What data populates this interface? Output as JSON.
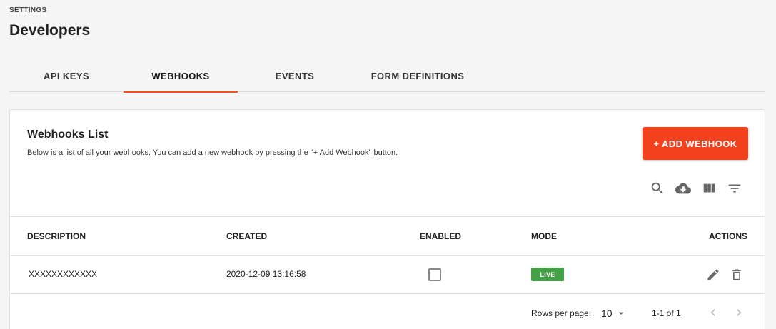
{
  "header": {
    "section_label": "SETTINGS",
    "title": "Developers"
  },
  "tabs": [
    {
      "label": "API KEYS",
      "active": false
    },
    {
      "label": "WEBHOOKS",
      "active": true
    },
    {
      "label": "EVENTS",
      "active": false
    },
    {
      "label": "FORM DEFINITIONS",
      "active": false
    }
  ],
  "card": {
    "title": "Webhooks List",
    "subtitle": "Below is a list of all your webhooks. You can add a new webhook by pressing the \"+ Add Webhook\" button.",
    "add_button_label": "+ ADD WEBHOOK",
    "toolbar_icons": [
      "search-icon",
      "cloud-download-icon",
      "view-columns-icon",
      "filter-list-icon"
    ]
  },
  "table": {
    "columns": [
      "DESCRIPTION",
      "CREATED",
      "ENABLED",
      "MODE",
      "ACTIONS"
    ],
    "rows": [
      {
        "description": "XXXXXXXXXXXX",
        "created": "2020-12-09 13:16:58",
        "enabled": false,
        "mode": "LIVE"
      }
    ]
  },
  "pagination": {
    "rows_per_page_label": "Rows per page:",
    "rows_per_page_value": "10",
    "range_label": "1-1 of 1"
  },
  "colors": {
    "accent": "#f4411d",
    "live_badge": "#43a047"
  }
}
